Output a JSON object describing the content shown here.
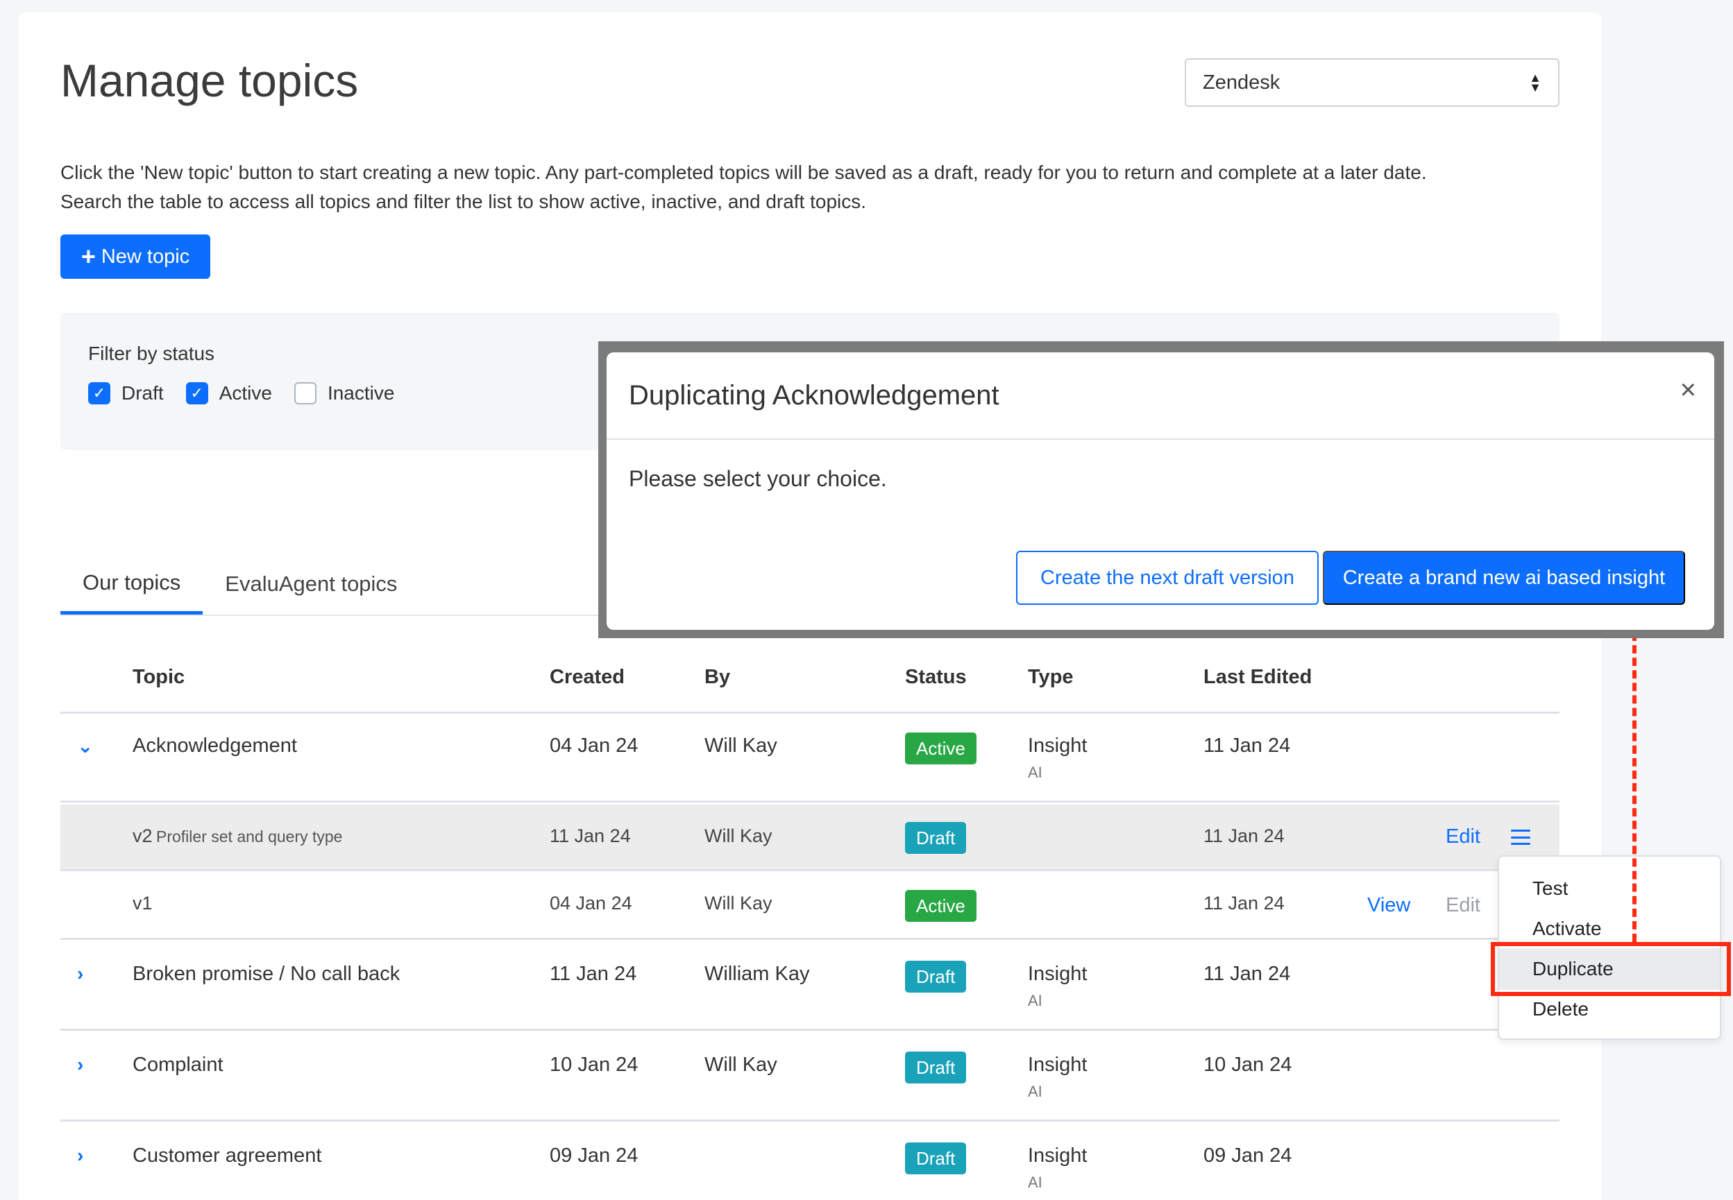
{
  "page": {
    "title": "Manage topics",
    "source_select": "Zendesk",
    "intro_line1": "Click the 'New topic' button to start creating a new topic. Any part-completed topics will be saved as a draft, ready for you to return and complete at a later date.",
    "intro_line2": "Search the table to access all topics and filter the list to show active, inactive, and draft topics.",
    "new_topic_label": "New topic"
  },
  "filter": {
    "label": "Filter by status",
    "options": [
      {
        "label": "Draft",
        "checked": true
      },
      {
        "label": "Active",
        "checked": true
      },
      {
        "label": "Inactive",
        "checked": false
      }
    ]
  },
  "tabs": [
    {
      "label": "Our topics",
      "active": true
    },
    {
      "label": "EvaluAgent topics",
      "active": false
    }
  ],
  "table": {
    "headers": {
      "topic": "Topic",
      "created": "Created",
      "by": "By",
      "status": "Status",
      "type": "Type",
      "last_edited": "Last Edited"
    },
    "rows": [
      {
        "topic": "Acknowledgement",
        "created": "04 Jan 24",
        "by": "Will Kay",
        "status": "Active",
        "type": "Insight",
        "type_sub": "AI",
        "last_edited": "11 Jan 24"
      },
      {
        "version": "v2",
        "version_name": "Profiler set and query type",
        "created": "11 Jan 24",
        "by": "Will Kay",
        "status": "Draft",
        "last_edited": "11 Jan 24",
        "edit": "Edit"
      },
      {
        "version": "v1",
        "created": "04 Jan 24",
        "by": "Will Kay",
        "status": "Active",
        "last_edited": "11 Jan 24",
        "view": "View",
        "edit": "Edit"
      },
      {
        "topic": "Broken promise / No call back",
        "created": "11 Jan 24",
        "by": "William Kay",
        "status": "Draft",
        "type": "Insight",
        "type_sub": "AI",
        "last_edited": "11 Jan 24"
      },
      {
        "topic": "Complaint",
        "created": "10 Jan 24",
        "by": "Will Kay",
        "status": "Draft",
        "type": "Insight",
        "type_sub": "AI",
        "last_edited": "10 Jan 24"
      },
      {
        "topic": "Customer agreement",
        "created": "09 Jan 24",
        "by": "",
        "status": "Draft",
        "type": "Insight",
        "type_sub": "AI",
        "last_edited": "09 Jan 24"
      }
    ]
  },
  "dropdown": {
    "items": [
      "Test",
      "Activate",
      "Duplicate",
      "Delete"
    ]
  },
  "modal": {
    "title": "Duplicating Acknowledgement",
    "close": "×",
    "body": "Please select your choice.",
    "btn_next_draft": "Create the next draft version",
    "btn_new_insight": "Create a brand new ai based insight"
  },
  "colors": {
    "primary": "#0d6efd",
    "active_badge": "#28a745",
    "draft_badge": "#1aa2b8",
    "annotation": "#ff2a12"
  }
}
